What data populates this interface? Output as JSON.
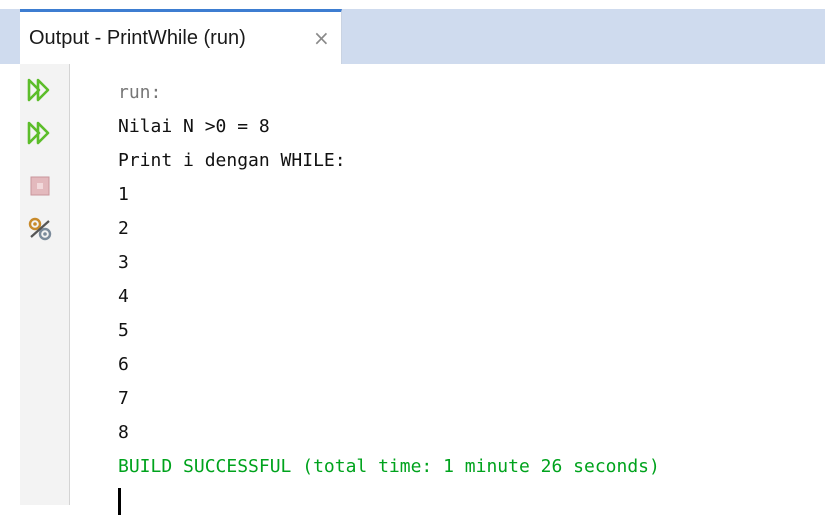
{
  "window": {
    "tab_title": "Output - PrintWhile (run)",
    "tab_close": "×"
  },
  "toolbar": {
    "buttons": [
      {
        "icon": "rerun-icon",
        "label": "Re-run"
      },
      {
        "icon": "rerun-options-icon",
        "label": "Re-run with options"
      },
      {
        "icon": "stop-icon",
        "label": "Stop"
      },
      {
        "icon": "settings-icon",
        "label": "Settings"
      }
    ]
  },
  "output": {
    "lines": [
      {
        "text": "run:",
        "kind": "prompt"
      },
      {
        "text": "Nilai N >0 = 8",
        "kind": "normal"
      },
      {
        "text": "Print i dengan WHILE:",
        "kind": "normal"
      },
      {
        "text": "1",
        "kind": "normal"
      },
      {
        "text": "2",
        "kind": "normal"
      },
      {
        "text": "3",
        "kind": "normal"
      },
      {
        "text": "4",
        "kind": "normal"
      },
      {
        "text": "5",
        "kind": "normal"
      },
      {
        "text": "6",
        "kind": "normal"
      },
      {
        "text": "7",
        "kind": "normal"
      },
      {
        "text": "8",
        "kind": "normal"
      },
      {
        "text": "BUILD SUCCESSFUL (total time: 1 minute 26 seconds)",
        "kind": "success"
      }
    ]
  },
  "colors": {
    "tab_accent": "#3d7dd1",
    "tabstrip_bg": "#cfdbee",
    "success_text": "#00a31d",
    "prompt_text": "#777777",
    "rerun_icon": "#5cbd2a"
  }
}
